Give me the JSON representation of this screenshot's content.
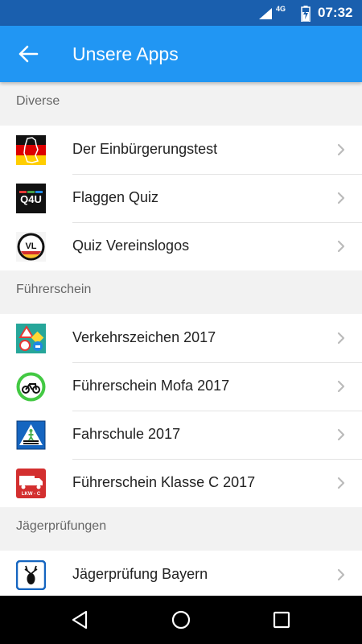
{
  "status_bar": {
    "network": "4G",
    "time": "07:32"
  },
  "app_bar": {
    "title": "Unsere Apps",
    "back_icon": "arrow-left-icon"
  },
  "sections": [
    {
      "title": "Diverse",
      "items": [
        {
          "label": "Der Einbürgerungstest",
          "icon": "germany-map-icon"
        },
        {
          "label": "Flaggen Quiz",
          "icon": "q4u-logo-icon",
          "icon_text": "Q4U"
        },
        {
          "label": "Quiz Vereinslogos",
          "icon": "vl-logo-icon",
          "icon_text": "VL"
        }
      ]
    },
    {
      "title": "Führerschein",
      "items": [
        {
          "label": "Verkehrszeichen 2017",
          "icon": "traffic-signs-icon"
        },
        {
          "label": "Führerschein Mofa 2017",
          "icon": "mofa-sign-icon"
        },
        {
          "label": "Fahrschule 2017",
          "icon": "crosswalk-sign-icon"
        },
        {
          "label": "Führerschein Klasse C 2017",
          "icon": "truck-sign-icon",
          "icon_text": "LKW - C"
        }
      ]
    },
    {
      "title": "Jägerprüfungen",
      "items": [
        {
          "label": "Jägerprüfung Bayern",
          "icon": "deer-crest-icon"
        }
      ]
    }
  ],
  "colors": {
    "status_bar": "#1a5fae",
    "app_bar": "#2196f3",
    "background": "#f2f2f2",
    "nav_bar": "#000000"
  }
}
